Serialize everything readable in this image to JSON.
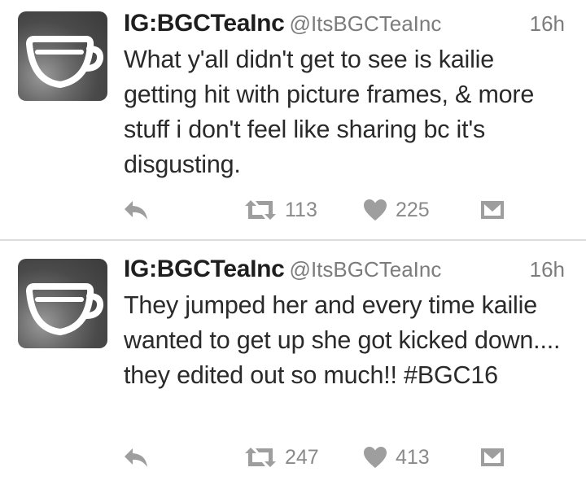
{
  "tweets": [
    {
      "name": "IG:BGCTeaInc",
      "handle": "@ItsBGCTeaInc",
      "time": "16h",
      "text": "What y'all didn't get to see is kailie getting hit with picture frames, & more stuff i don't feel like sharing bc it's disgusting.",
      "retweets": "113",
      "likes": "225"
    },
    {
      "name": "IG:BGCTeaInc",
      "handle": "@ItsBGCTeaInc",
      "time": "16h",
      "text": "They jumped her and every time kailie wanted to get up she got kicked down.... they edited out so much!! #BGC16",
      "retweets": "247",
      "likes": "413"
    }
  ],
  "icons": {
    "avatar": "teacup-icon",
    "reply": "reply-icon",
    "retweet": "retweet-icon",
    "like": "heart-icon",
    "dm": "direct-message-icon"
  },
  "colors": {
    "text": "#2a2a2a",
    "muted": "#8a8a8a",
    "icon": "#9e9e9e",
    "divider": "#dcdcdc"
  }
}
